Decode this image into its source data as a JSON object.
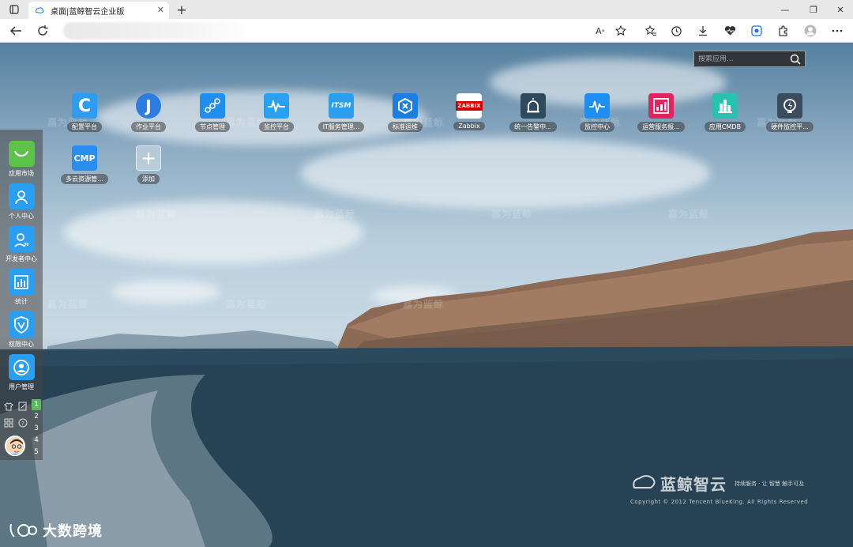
{
  "browser": {
    "tab_title": "桌面|蓝鲸智云企业版",
    "close_glyph": "✕",
    "new_tab_glyph": "+",
    "window_controls": [
      "—",
      "❐",
      "✕"
    ],
    "reader_label": "A"
  },
  "search": {
    "placeholder": "搜索应用..."
  },
  "apps": [
    {
      "label": "配置平台",
      "icon": "cmdb-c-icon",
      "color": "#2e9cf0",
      "glyph": "C"
    },
    {
      "label": "作业平台",
      "icon": "job-j-icon",
      "color": "#2b7de2",
      "glyph": "J"
    },
    {
      "label": "节点管理",
      "icon": "node-icon",
      "color": "#1e8ff0",
      "glyph": ""
    },
    {
      "label": "监控平台",
      "icon": "monitor-wave-icon",
      "color": "#2aa0f0",
      "glyph": ""
    },
    {
      "label": "IT服务管理...",
      "icon": "itsm-icon",
      "color": "#2b9ef0",
      "glyph": "ITSM"
    },
    {
      "label": "标准运维",
      "icon": "sops-icon",
      "color": "#1a7fe0",
      "glyph": ""
    },
    {
      "label": "Zabbix",
      "icon": "zabbix-icon",
      "color": "#ffffff",
      "glyph": "ZABBIX"
    },
    {
      "label": "统一告警中...",
      "icon": "alarm-icon",
      "color": "#2f4a5c",
      "glyph": ""
    },
    {
      "label": "监控中心",
      "icon": "monitor-center-icon",
      "color": "#1e8ff0",
      "glyph": ""
    },
    {
      "label": "运营服务报...",
      "icon": "report-icon",
      "color": "#e0245e",
      "glyph": ""
    },
    {
      "label": "应用CMDB",
      "icon": "app-cmdb-icon",
      "color": "#27c3b0",
      "glyph": ""
    },
    {
      "label": "硬件监控平...",
      "icon": "hardware-icon",
      "color": "#3a4d5c",
      "glyph": ""
    },
    {
      "label": "多云资源管...",
      "icon": "cmp-icon",
      "color": "#2a8ef0",
      "glyph": "CMP"
    },
    {
      "label": "添加",
      "icon": "add-icon",
      "color": "rgba(255,255,255,0.35)",
      "glyph": "+"
    }
  ],
  "dock": [
    {
      "label": "应用市场",
      "icon": "app-market-icon",
      "color": "#5cc24a"
    },
    {
      "label": "个人中心",
      "icon": "personal-center-icon",
      "color": "#2a9ef0"
    },
    {
      "label": "开发者中心",
      "icon": "developer-center-icon",
      "color": "#2a9ef0"
    },
    {
      "label": "统计",
      "icon": "statistics-icon",
      "color": "#2a9ef0"
    },
    {
      "label": "权限中心",
      "icon": "permission-center-icon",
      "color": "#2a9ef0"
    },
    {
      "label": "用户管理",
      "icon": "user-manage-icon",
      "color": "#2a9ef0"
    }
  ],
  "pages": [
    "1",
    "2",
    "3",
    "4",
    "5"
  ],
  "brand": {
    "name": "蓝鲸智云",
    "slogan": "持续服务 · 让 智慧 触手可及",
    "copyright": "Copyright © 2012 Tencent BlueKing. All Rights Reserved"
  },
  "watermark_text": "嘉为蓝鲸",
  "corner_logo": {
    "name": "大数跨境"
  }
}
